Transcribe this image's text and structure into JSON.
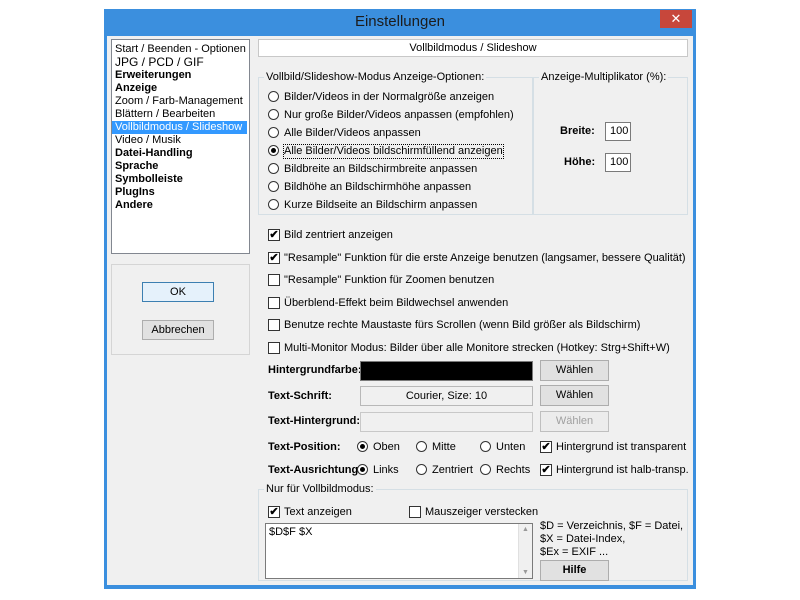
{
  "window": {
    "title": "Einstellungen",
    "close_glyph": "✕",
    "accent": "#3b8fde",
    "close_color": "#c7473b"
  },
  "nav": {
    "items": [
      {
        "label": "Start / Beenden - Optionen"
      },
      {
        "label": "JPG / PCD / GIF"
      },
      {
        "label": "Erweiterungen"
      },
      {
        "label": "Anzeige"
      },
      {
        "label": "Zoom / Farb-Management"
      },
      {
        "label": "Blättern / Bearbeiten"
      },
      {
        "label": "Vollbildmodus / Slideshow"
      },
      {
        "label": "Video / Musik"
      },
      {
        "label": "Datei-Handling"
      },
      {
        "label": "Sprache"
      },
      {
        "label": "Symbolleiste"
      },
      {
        "label": "PlugIns"
      },
      {
        "label": "Andere"
      }
    ],
    "selected": "Vollbildmodus / Slideshow"
  },
  "buttons": {
    "ok": "OK",
    "cancel": "Abbrechen",
    "help": "Hilfe"
  },
  "page": {
    "header": "Vollbildmodus / Slideshow",
    "display_options": {
      "title": "Vollbild/Slideshow-Modus Anzeige-Optionen:",
      "options": [
        "Bilder/Videos in der Normalgröße anzeigen",
        "Nur große Bilder/Videos anpassen (empfohlen)",
        "Alle Bilder/Videos anpassen",
        "Alle Bilder/Videos bildschirmfüllend anzeigen",
        "Bildbreite an Bildschirmbreite anpassen",
        "Bildhöhe an Bildschirmhöhe anpassen",
        "Kurze Bildseite an Bildschirm anpassen"
      ],
      "selected": "Alle Bilder/Videos bildschirmfüllend anzeigen"
    },
    "multiplier": {
      "title": "Anzeige-Multiplikator (%):",
      "width_label": "Breite:",
      "width_value": "100",
      "height_label": "Höhe:",
      "height_value": "100"
    },
    "checkboxes": [
      {
        "label": "Bild zentriert anzeigen",
        "checked": true
      },
      {
        "label": "\"Resample\" Funktion für die erste Anzeige benutzen (langsamer, bessere Qualität)",
        "checked": true
      },
      {
        "label": "\"Resample\" Funktion für Zoomen benutzen",
        "checked": false
      },
      {
        "label": "Überblend-Effekt beim Bildwechsel anwenden",
        "checked": false
      },
      {
        "label": "Benutze rechte Maustaste fürs Scrollen (wenn Bild größer als Bildschirm)",
        "checked": false
      },
      {
        "label": "Multi-Monitor Modus: Bilder über alle Monitore strecken (Hotkey: Strg+Shift+W)",
        "checked": false
      }
    ],
    "background": {
      "label": "Hintergrundfarbe:",
      "color": "#000000",
      "button": "Wählen"
    },
    "font": {
      "label": "Text-Schrift:",
      "value": "Courier, Size: 10",
      "button": "Wählen"
    },
    "text_background": {
      "label": "Text-Hintergrund:",
      "value": "",
      "button": "Wählen"
    },
    "text_position": {
      "label": "Text-Position:",
      "options": [
        "Oben",
        "Mitte",
        "Unten"
      ],
      "selected": "Oben",
      "check_label": "Hintergrund ist transparent",
      "check": true
    },
    "text_alignment": {
      "label": "Text-Ausrichtung:",
      "options": [
        "Links",
        "Zentriert",
        "Rechts"
      ],
      "selected": "Links",
      "check_label": "Hintergrund ist halb-transp.",
      "check": true
    },
    "fullscreen_only": {
      "title": "Nur für Vollbildmodus:",
      "show_text_label": "Text anzeigen",
      "show_text": true,
      "hide_cursor_label": "Mauszeiger verstecken",
      "hide_cursor": false,
      "text_template": "$D$F $X",
      "hint_1": "$D = Verzeichnis, $F = Datei,",
      "hint_2": "$X = Datei-Index,",
      "hint_3": "$Ex = EXIF ..."
    }
  }
}
